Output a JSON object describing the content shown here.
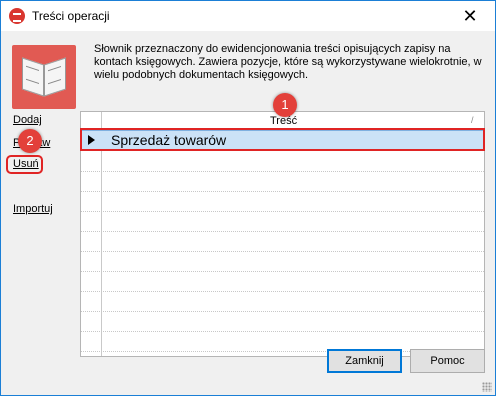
{
  "window": {
    "title": "Treści operacji"
  },
  "titlebar": {
    "close_glyph": "✕"
  },
  "description": "Słownik przeznaczony do ewidencjonowania treści opisujących zapisy na kontach księgowych. Zawiera pozycje, które są wykorzystywane wielokrotnie, w wielu podobnych dokumentach księgowych.",
  "sidebar": {
    "items": [
      {
        "label": "Dodaj"
      },
      {
        "label": "Popraw"
      },
      {
        "label": "Usuń"
      },
      {
        "label": "Importuj"
      }
    ]
  },
  "grid": {
    "column_header": "Treść",
    "sort_glyph": "/",
    "rows": [
      {
        "text": "Sprzedaż towarów",
        "selected": true
      }
    ],
    "empty_row_count": 10
  },
  "badges": [
    "1",
    "2"
  ],
  "buttons": {
    "close_label": "Zamknij",
    "help_label": "Pomoc"
  },
  "colors": {
    "highlight_red": "#e02424",
    "badge_red": "#e3403a",
    "selection_blue": "#cbe2f7",
    "window_border": "#1b7fd6"
  },
  "icons": {
    "app": "app-logo-icon",
    "header": "open-book-icon",
    "row_indicator": "row-pointer-icon"
  }
}
